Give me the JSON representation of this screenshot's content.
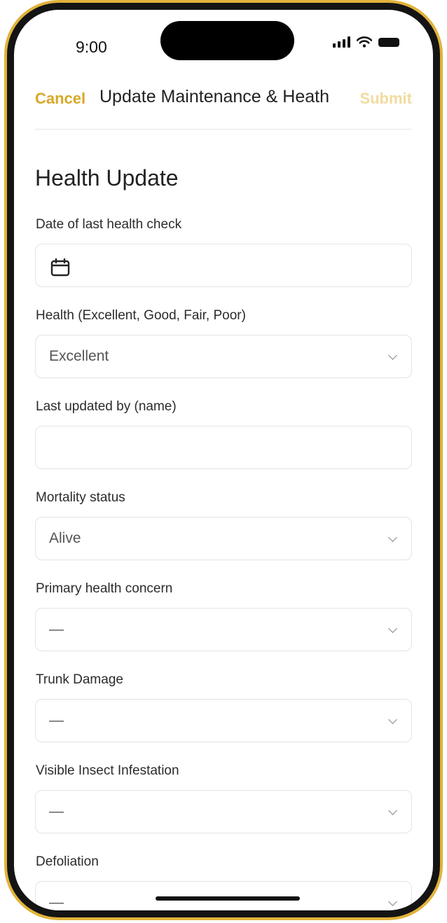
{
  "status_bar": {
    "time": "9:00"
  },
  "nav": {
    "cancel_label": "Cancel",
    "title": "Update Maintenance & Heath",
    "submit_label": "Submit"
  },
  "section": {
    "title": "Health Update"
  },
  "fields": [
    {
      "label": "Date of last health check",
      "value": "",
      "type": "date",
      "icon": "calendar-icon"
    },
    {
      "label": "Health (Excellent, Good, Fair, Poor)",
      "value": "Excellent",
      "type": "select"
    },
    {
      "label": "Last updated by (name)",
      "value": "",
      "type": "text"
    },
    {
      "label": "Mortality status",
      "value": "Alive",
      "type": "select"
    },
    {
      "label": "Primary health concern",
      "value": "—",
      "type": "select"
    },
    {
      "label": "Trunk Damage",
      "value": "—",
      "type": "select"
    },
    {
      "label": "Visible Insect Infestation",
      "value": "—",
      "type": "select"
    },
    {
      "label": "Defoliation",
      "value": "—",
      "type": "select"
    }
  ],
  "colors": {
    "accent": "#d8a827",
    "accent_disabled": "#f0dca0",
    "frame": "#e1b23a"
  }
}
